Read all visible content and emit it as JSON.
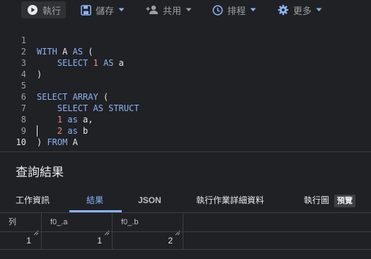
{
  "toolbar": {
    "run_label": "執行",
    "save_label": "儲存",
    "share_label": "共用",
    "schedule_label": "排程",
    "more_label": "更多"
  },
  "editor": {
    "line_numbers": [
      "1",
      "2",
      "3",
      "4",
      "5",
      "6",
      "7",
      "8",
      "9",
      "10"
    ],
    "lines": [
      "WITH A AS (",
      "    SELECT 1 AS a",
      ")",
      "",
      "SELECT ARRAY (",
      "    SELECT AS STRUCT",
      "    1 as a,",
      "    2 as b",
      ") FROM A",
      ""
    ]
  },
  "results": {
    "title": "查詢結果",
    "tabs": [
      "工作資訊",
      "結果",
      "JSON",
      "執行作業詳細資料",
      "執行圖"
    ],
    "active_tab": "結果",
    "preview_badge": "預覽",
    "columns": [
      "列",
      "f0_.a",
      "f0_.b"
    ],
    "rows": [
      [
        "1",
        "1",
        "2"
      ]
    ]
  },
  "colors": {
    "background": "#202124",
    "accent": "#8ab4f8",
    "keyword": "#8ab4f8",
    "number": "#f28b82"
  },
  "icons": [
    "play-icon",
    "save-icon",
    "person-add-icon",
    "clock-icon",
    "gear-icon",
    "caret-down-icon",
    "resize-grip-icon"
  ]
}
